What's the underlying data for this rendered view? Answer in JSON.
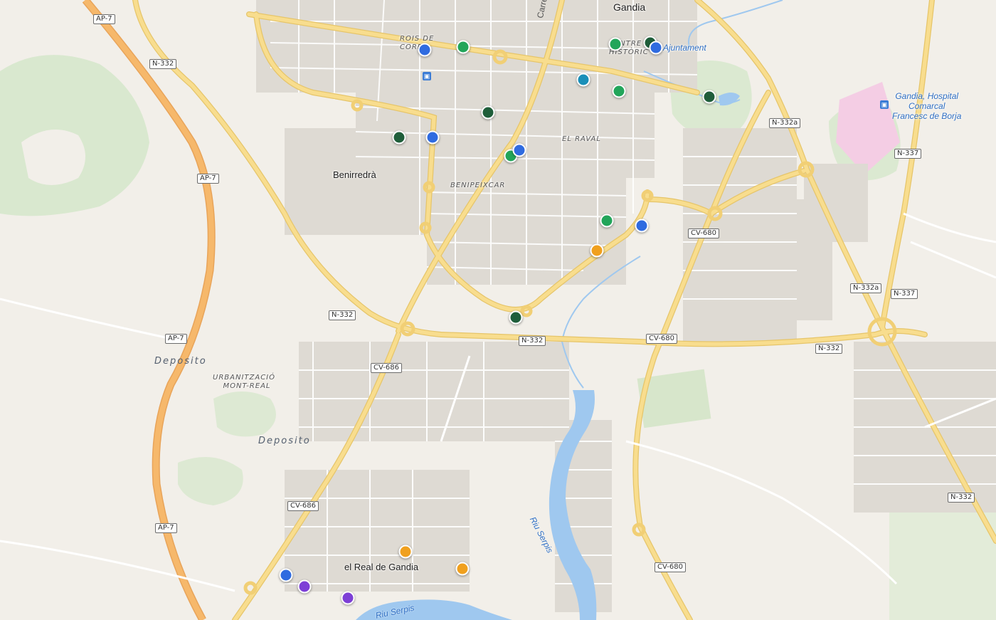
{
  "map": {
    "places": {
      "gandia": "Gandia",
      "benirredra": "Benirredrà",
      "real_de_gandia": "el Real de Gandia",
      "rois_de_corella_1": "ROIS DE",
      "rois_de_corella_2": "CORE",
      "centre_historic_1": "CENTRE",
      "centre_historic_2": "HISTÒRIC",
      "el_raval": "EL RAVAL",
      "benipeixcar": "BENIPEIXCAR",
      "urbanitzacio_1": "URBANITZACIÓ",
      "urbanitzacio_2": "MONT-REAL",
      "deposito_1": "Deposito",
      "deposito_2": "Deposito",
      "street_carrer_sant": "Carrer Sant",
      "river_1": "Riu Serpis",
      "river_2": "Riu Serpis"
    },
    "pois": {
      "ajuntament": "Ajuntament",
      "hospital_1": "Gandia, Hospital",
      "hospital_2": "Comarcal",
      "hospital_3": "Francesc de Borja"
    },
    "roads": {
      "ap7_a": "AP-7",
      "ap7_b": "AP-7",
      "ap7_c": "AP-7",
      "ap7_d": "AP-7",
      "n332_a": "N-332",
      "n332_b": "N-332",
      "n332_c": "N-332",
      "n332_d": "N-332",
      "n332_e": "N-332",
      "n332a_a": "N-332a",
      "n332a_b": "N-332a",
      "n337_a": "N-337",
      "n337_b": "N-337",
      "cv680_a": "CV-680",
      "cv680_b": "CV-680",
      "cv680_c": "CV-680",
      "cv686_a": "CV-686",
      "cv686_b": "CV-686"
    },
    "colors": {
      "background": "#f2efe9",
      "blue": "#2f6be0",
      "green": "#22a55a",
      "dark_green": "#1f5e3a",
      "teal": "#1a8fb8",
      "orange": "#f0a01e",
      "purple": "#7d3fd6",
      "river": "#9fc8ef",
      "highway": "#f6b86b",
      "main_road": "#f8dd8e"
    },
    "markers": [
      {
        "color": "blue"
      },
      {
        "color": "green"
      },
      {
        "color": "green"
      },
      {
        "color": "dark_green"
      },
      {
        "color": "blue"
      },
      {
        "color": "teal"
      },
      {
        "color": "green"
      },
      {
        "color": "dark_green"
      },
      {
        "color": "dark_green"
      },
      {
        "color": "dark_green"
      },
      {
        "color": "blue"
      },
      {
        "color": "green"
      },
      {
        "color": "blue"
      },
      {
        "color": "green"
      },
      {
        "color": "blue"
      },
      {
        "color": "orange"
      },
      {
        "color": "dark_green"
      },
      {
        "color": "orange"
      },
      {
        "color": "orange"
      },
      {
        "color": "blue"
      },
      {
        "color": "purple"
      },
      {
        "color": "purple"
      }
    ]
  }
}
